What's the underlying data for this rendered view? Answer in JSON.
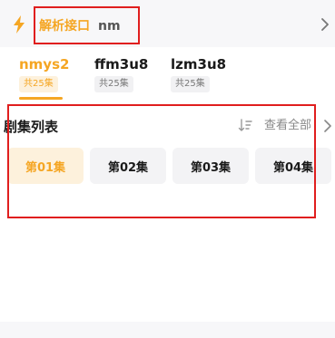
{
  "parse_interface": {
    "label": "解析接口",
    "value": "nm"
  },
  "sources": [
    {
      "name": "nmys2",
      "count": "共25集",
      "active": true
    },
    {
      "name": "ffm3u8",
      "count": "共25集",
      "active": false
    },
    {
      "name": "lzm3u8",
      "count": "共25集",
      "active": false
    }
  ],
  "episode_list": {
    "title": "剧集列表",
    "view_all": "查看全部",
    "episodes": [
      "第01集",
      "第02集",
      "第03集",
      "第04集"
    ]
  },
  "colors": {
    "accent": "#f5a623",
    "highlight": "#e01e1e"
  },
  "icons": {
    "parse": "lightning-bolt-icon",
    "sort": "sort-icon",
    "more": "chevron-right-icon"
  }
}
